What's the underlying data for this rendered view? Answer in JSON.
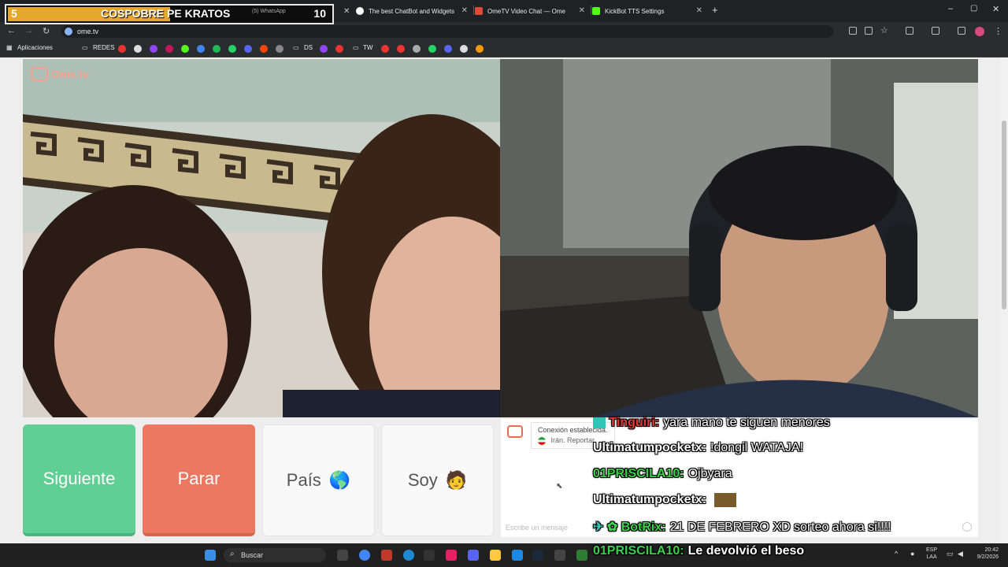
{
  "overlay": {
    "count_left": "5",
    "title": "COSPOBRE PE KRATOS",
    "count_right": "10",
    "tab_hint": "(5) WhatsApp"
  },
  "tabs": [
    {
      "label": "The best ChatBot and Widgets",
      "color": "#ffffff"
    },
    {
      "label": "OmeTV Video Chat — Ome",
      "color": "#e04a3a"
    },
    {
      "label": "KickBot TTS Settings",
      "color": "#53fc18"
    }
  ],
  "address": {
    "url": "ome.tv"
  },
  "bookmarks": {
    "apps": "Aplicaciones",
    "folder1": "REDES",
    "folder2": "DS",
    "folder3": "TW"
  },
  "logo": {
    "text": "Ome.tv",
    "color": "#f06b4e"
  },
  "buttons": {
    "next": "Siguiente",
    "stop": "Parar",
    "country": "País",
    "country_emoji": "🌎",
    "gender": "Soy",
    "gender_emoji": "🧑"
  },
  "chat": {
    "status": "Conexión establecida.",
    "country_line": "Irán. Reportar",
    "input_placeholder": "Escribe un mensaje"
  },
  "stream_chat": [
    {
      "user": "Tinguiri:",
      "user_color": "#e53935",
      "message": "yara mano te siguen menores"
    },
    {
      "user": "Ultimatumpocketx:",
      "user_color": "#ffffff",
      "message": "!dongil WATAJA!"
    },
    {
      "user": "01PRISCILA10:",
      "user_color": "#3ad14a",
      "message": "Ojbyara"
    },
    {
      "user": "Ultimatumpocketx:",
      "user_color": "#ffffff",
      "message": ""
    },
    {
      "user": "BotRix:",
      "user_color": "#3ad14a",
      "message": "21 DE FEBRERO XD sorteo ahora si!!!!"
    }
  ],
  "stream_footer": {
    "user": "01PRISCILA10:",
    "message": "Le devolvió el beso"
  },
  "taskbar": {
    "search": "Buscar",
    "lang1": "ESP",
    "lang2": "LAA",
    "time": "20:42",
    "date": "9/2/2026"
  }
}
